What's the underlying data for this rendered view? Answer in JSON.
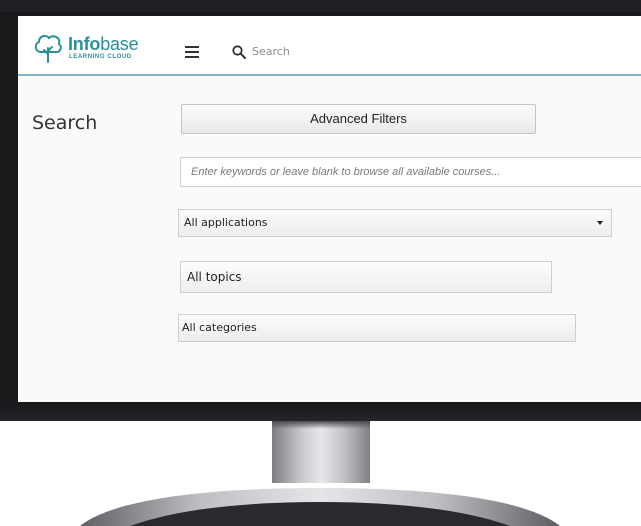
{
  "header": {
    "logo_brand_bold": "Info",
    "logo_brand_light": "base",
    "logo_tagline": "LEARNING CLOUD",
    "search_label": "Search"
  },
  "main": {
    "page_title": "Search",
    "advanced_filters_label": "Advanced Filters",
    "keyword_placeholder": "Enter keywords or leave blank to browse all available courses...",
    "applications_selected": "All applications",
    "topics_selected": "All topics",
    "categories_selected": "All categories"
  },
  "colors": {
    "brand": "#2a8f99",
    "header_border": "#7fb6c0",
    "monitor_frame": "#1a1a1c"
  },
  "icons": [
    "logo-tree-icon",
    "menu-icon",
    "search-icon",
    "dropdown-caret-icon"
  ]
}
